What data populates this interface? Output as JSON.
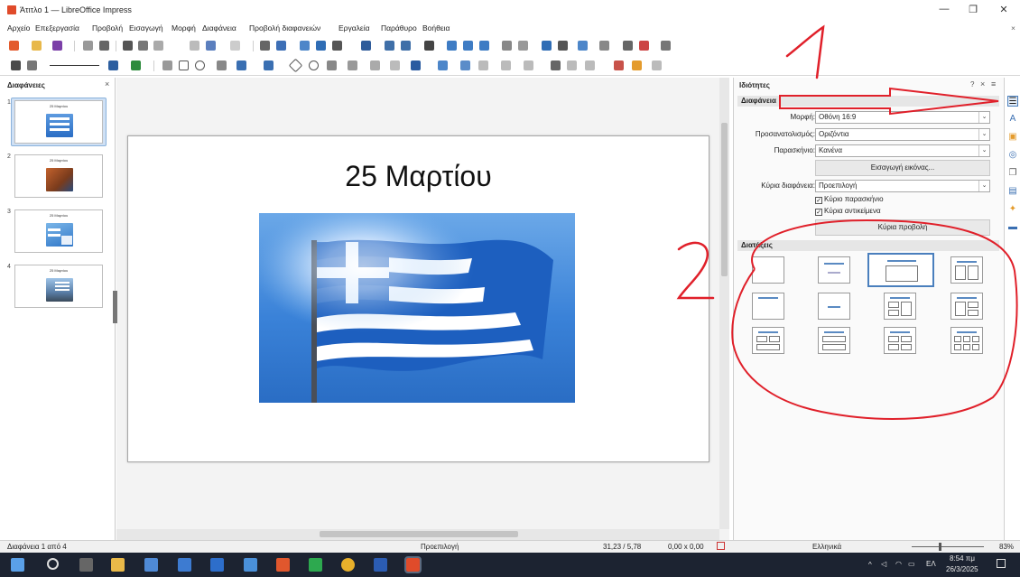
{
  "window": {
    "title": "Άτιτλο 1 — LibreOffice Impress",
    "minimize": "—",
    "maximize": "❐",
    "close": "✕",
    "doc_close": "×"
  },
  "menu": [
    "Αρχείο",
    "Επεξεργασία",
    "Προβολή",
    "Εισαγωγή",
    "Μορφή",
    "Διαφάνεια",
    "Προβολή διαφανειών",
    "Εργαλεία",
    "Παράθυρο",
    "Βοήθεια"
  ],
  "slides_panel": {
    "title": "Διαφάνειες",
    "close": "×",
    "slides": [
      {
        "num": "1",
        "title": "25 Μαρτίου",
        "selected": true,
        "image": "flag"
      },
      {
        "num": "2",
        "title": "25 Μαρτίου",
        "selected": false,
        "image": "painting"
      },
      {
        "num": "3",
        "title": "25 Μαρτίου",
        "selected": false,
        "image": "flag-text"
      },
      {
        "num": "4",
        "title": "25 Μαρτίου",
        "selected": false,
        "image": "flag-city"
      }
    ]
  },
  "slide": {
    "title": "25 Μαρτίου",
    "image_name": "greek-flag-photo"
  },
  "sidebar": {
    "title": "Ιδιότητες",
    "help": "?",
    "close": "×",
    "menu": "≡",
    "slide_section": "Διαφάνεια",
    "format_label": "Μορφή:",
    "format_value": "Οθόνη 16:9",
    "orientation_label": "Προσανατολισμός:",
    "orientation_value": "Οριζόντια",
    "background_label": "Παρασκήνιο:",
    "background_value": "Κανένα",
    "insert_image_button": "Εισαγωγή εικόνας...",
    "master_label": "Κύρια διαφάνεια:",
    "master_value": "Προεπιλογή",
    "master_background_check": "Κύριο παρασκήνιο",
    "master_objects_check": "Κύρια αντικείμενα",
    "master_view_button": "Κύρια προβολή",
    "layouts_section": "Διατάξεις",
    "selected_layout_index": 2
  },
  "statusbar": {
    "slide_position": "Διαφάνεια 1 από 4",
    "master": "Προεπιλογή",
    "position": "31,23 / 5,78",
    "size": "0,00 x 0,00",
    "language": "Ελληνικά",
    "zoom": "83%"
  },
  "taskbar": {
    "time": "8:54 πμ",
    "date": "26/3/2025",
    "lang": "ΕΛ"
  },
  "annotations": {
    "mark_1": "1",
    "mark_2": "2"
  },
  "colors": {
    "selection": "#cfe0f4",
    "accent": "#4a7fbd",
    "annotation_red": "#e0202a",
    "taskbar": "#1c2331"
  }
}
